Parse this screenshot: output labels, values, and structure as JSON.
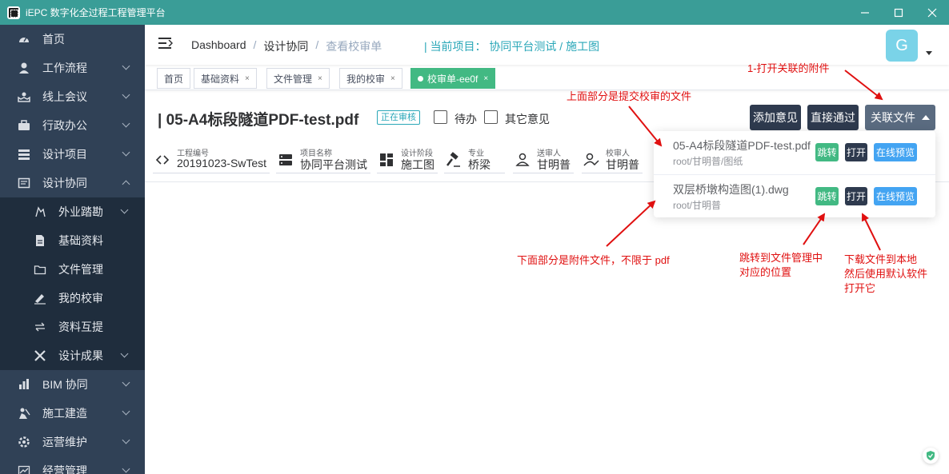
{
  "window": {
    "title": "iEPC 数字化全过程工程管理平台",
    "controls": [
      "minimize",
      "maximize",
      "close"
    ]
  },
  "sidebar": {
    "items": [
      {
        "label": "首页",
        "icon": "dashboard-icon"
      },
      {
        "label": "工作流程",
        "icon": "user-icon"
      },
      {
        "label": "线上会议",
        "icon": "meeting-icon"
      },
      {
        "label": "行政办公",
        "icon": "briefcase-icon"
      },
      {
        "label": "设计项目",
        "icon": "list-icon"
      },
      {
        "label": "设计协同",
        "icon": "form-icon"
      }
    ],
    "sub_items": [
      {
        "label": "外业踏勘",
        "icon": "survey-icon"
      },
      {
        "label": "基础资料",
        "icon": "document-icon"
      },
      {
        "label": "文件管理",
        "icon": "folder-icon"
      },
      {
        "label": "我的校审",
        "icon": "sign-icon"
      },
      {
        "label": "资料互提",
        "icon": "exchange-icon"
      },
      {
        "label": "设计成果",
        "icon": "tools-icon"
      }
    ],
    "bottom_items": [
      {
        "label": "BIM 协同",
        "icon": "bim-icon"
      },
      {
        "label": "施工建造",
        "icon": "construction-icon"
      },
      {
        "label": "运营维护",
        "icon": "maintenance-icon"
      },
      {
        "label": "经营管理",
        "icon": "chart-icon"
      }
    ]
  },
  "header": {
    "breadcrumb": [
      "Dashboard",
      "设计协同",
      "查看校审单"
    ],
    "project": "| 当前项目： 协同平台测试 / 施工图",
    "avatar_letter": "G"
  },
  "tags": [
    {
      "label": "首页",
      "closable": false
    },
    {
      "label": "基础资料",
      "closable": true
    },
    {
      "label": "文件管理",
      "closable": true
    },
    {
      "label": "我的校审",
      "closable": true
    },
    {
      "label": "校审单-ee0f",
      "closable": true,
      "active": true
    }
  ],
  "document": {
    "title": "| 05-A4标段隧道PDF-test.pdf",
    "status": "正在审核",
    "checkbox_todo": "待办",
    "checkbox_other": "其它意见"
  },
  "actions": {
    "add_opinion": "添加意见",
    "approve": "直接通过",
    "related_files": "关联文件"
  },
  "info": [
    {
      "label": "工程编号",
      "value": "20191023-SwTest",
      "icon": "code-icon"
    },
    {
      "label": "项目名称",
      "value": "协同平台测试",
      "icon": "server-icon"
    },
    {
      "label": "设计阶段",
      "value": "施工图",
      "icon": "layout-icon"
    },
    {
      "label": "专业",
      "value": "桥梁",
      "icon": "hammer-icon"
    },
    {
      "label": "送审人",
      "value": "甘明普",
      "icon": "person-icon"
    },
    {
      "label": "校审人",
      "value": "甘明普",
      "icon": "person-check-icon"
    }
  ],
  "related_files": [
    {
      "name": "05-A4标段隧道PDF-test.pdf",
      "path": "root/甘明普/图纸"
    },
    {
      "name": "双层桥墩构造图(1).dwg",
      "path": "root/甘明普"
    }
  ],
  "file_actions": {
    "jump": "跳转",
    "open": "打开",
    "preview": "在线预览"
  },
  "annotations": {
    "open_attachments": "1-打开关联的附件",
    "upper_part": "上面部分是提交校审的文件",
    "lower_part": "下面部分是附件文件，不限于 pdf",
    "jump_note_1": "跳转到文件管理中",
    "jump_note_2": "对应的位置",
    "open_note_1": "下载文件到本地",
    "open_note_2": "然后使用默认软件",
    "open_note_3": "打开它"
  },
  "colors": {
    "titlebar": "#3a9d97",
    "sidebar": "#304156",
    "accent": "#42b983",
    "annotation": "#e01010"
  }
}
